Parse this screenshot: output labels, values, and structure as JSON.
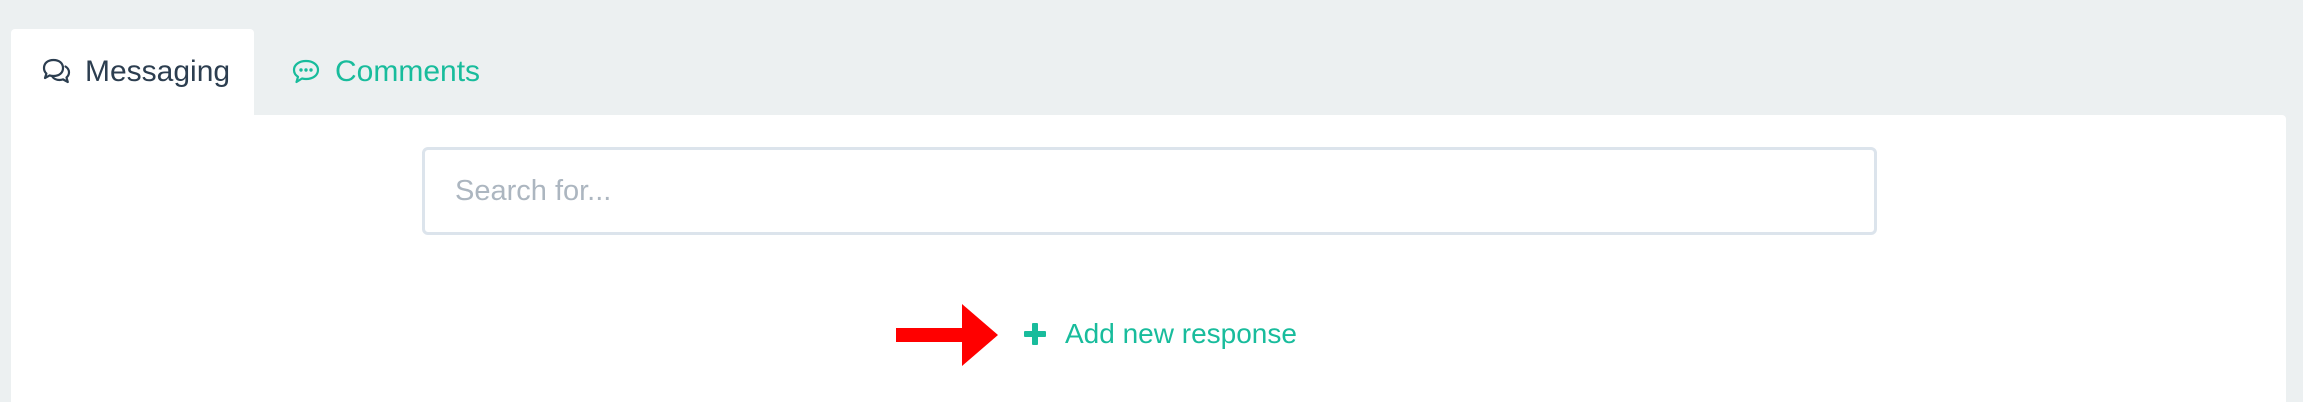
{
  "tabs": [
    {
      "label": "Messaging",
      "icon": "comments-outline-icon",
      "active": true
    },
    {
      "label": "Comments",
      "icon": "comment-dots-icon",
      "active": false
    }
  ],
  "search": {
    "placeholder": "Search for...",
    "value": ""
  },
  "add_response": {
    "label": "Add new response",
    "icon": "plus-icon"
  },
  "annotation": {
    "icon": "red-arrow-icon"
  },
  "colors": {
    "background": "#ecf0f1",
    "panel": "#ffffff",
    "accent": "#18bc9c",
    "text": "#2c3e50",
    "input_border": "#dce4ec",
    "placeholder": "#acb6c0",
    "arrow": "#ff0000"
  }
}
